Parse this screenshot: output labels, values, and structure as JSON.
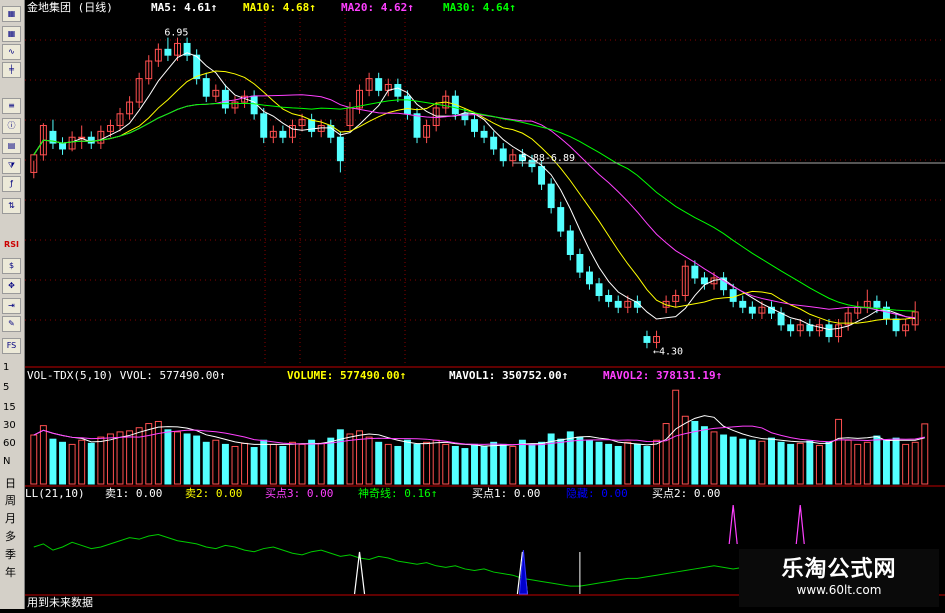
{
  "toolbar": {
    "icons": [
      "grid-icon",
      "grid-icon",
      "line-chart-icon",
      "candlestick-icon",
      "financial-icon",
      "stock-info-icon",
      "calendar-icon",
      "filter-icon",
      "formula-icon",
      "compare-icon",
      "rsi-icon",
      "dollar-icon",
      "move-icon",
      "export-icon",
      "draw-icon",
      "fullscreen-icon"
    ],
    "rsi_label": "RSI",
    "fs_label": "FS",
    "numbers": [
      "1",
      "5",
      "15",
      "30",
      "60",
      "N"
    ],
    "periods": [
      "日",
      "周",
      "月",
      "多",
      "季",
      "年"
    ]
  },
  "price_header": {
    "title": "金地集团 (日线)",
    "ma5": "MA5: 4.61↑",
    "ma10": "MA10: 4.68↑",
    "ma20": "MA20: 4.62↑",
    "ma30": "MA30: 4.64↑"
  },
  "vol_header": {
    "vvol": "VOL-TDX(5,10) VVOL: 577490.00↑",
    "volume": "VOLUME: 577490.00↑",
    "mavol1": "MAVOL1: 350752.00↑",
    "mavol2": "MAVOL2: 378131.19↑"
  },
  "ind_header": {
    "name": "LL(21,10)",
    "sell1": "卖1: 0.00",
    "sell2": "卖2: 0.00",
    "buy3": "买点3: 0.00",
    "magic": "神奇线: 0.16↑",
    "buy1": "买点1: 0.00",
    "hidden": "隐藏: 0.00",
    "buy2": "买点2: 0.00"
  },
  "footer_text": "用到未来数据",
  "watermark": {
    "title": "乐淘公式网",
    "url": "www.60lt.com"
  },
  "colors": {
    "up": "#ff5050",
    "down": "#54ffff",
    "ma5": "#ffffff",
    "ma10": "#ffff00",
    "ma20": "#ff40ff",
    "ma30": "#00ff00",
    "grid": "#8b0000"
  },
  "chart_data": [
    {
      "type": "candlestick",
      "title": "金地集团 (日线)",
      "annotations": [
        {
          "text": "6.95",
          "value": 6.95
        },
        {
          "text": "5.88-6.89",
          "value": 5.88
        },
        {
          "text": "4.30",
          "value": 4.3
        }
      ],
      "ylim": [
        4.2,
        7.1
      ],
      "candles": [
        [
          5.8,
          5.95,
          5.9,
          5.75
        ],
        [
          5.95,
          6.2,
          6.22,
          5.9
        ],
        [
          6.15,
          6.05,
          6.25,
          6.0
        ],
        [
          6.05,
          6.0,
          6.1,
          5.95
        ],
        [
          6.0,
          6.1,
          6.15,
          5.98
        ],
        [
          6.1,
          6.1,
          6.2,
          6.0
        ],
        [
          6.1,
          6.05,
          6.15,
          6.0
        ],
        [
          6.05,
          6.15,
          6.2,
          6.0
        ],
        [
          6.15,
          6.2,
          6.25,
          6.1
        ],
        [
          6.2,
          6.3,
          6.35,
          6.15
        ],
        [
          6.3,
          6.4,
          6.45,
          6.25
        ],
        [
          6.4,
          6.6,
          6.65,
          6.35
        ],
        [
          6.6,
          6.75,
          6.8,
          6.55
        ],
        [
          6.75,
          6.85,
          6.9,
          6.7
        ],
        [
          6.85,
          6.8,
          6.95,
          6.75
        ],
        [
          6.8,
          6.9,
          6.95,
          6.75
        ],
        [
          6.9,
          6.8,
          6.95,
          6.75
        ],
        [
          6.8,
          6.6,
          6.85,
          6.55
        ],
        [
          6.6,
          6.45,
          6.65,
          6.4
        ],
        [
          6.45,
          6.5,
          6.55,
          6.4
        ],
        [
          6.5,
          6.35,
          6.55,
          6.3
        ],
        [
          6.35,
          6.4,
          6.45,
          6.3
        ],
        [
          6.4,
          6.45,
          6.5,
          6.35
        ],
        [
          6.45,
          6.3,
          6.5,
          6.25
        ],
        [
          6.3,
          6.1,
          6.35,
          6.05
        ],
        [
          6.1,
          6.15,
          6.2,
          6.05
        ],
        [
          6.15,
          6.1,
          6.2,
          6.05
        ],
        [
          6.1,
          6.2,
          6.25,
          6.05
        ],
        [
          6.2,
          6.25,
          6.3,
          6.15
        ],
        [
          6.25,
          6.15,
          6.3,
          6.1
        ],
        [
          6.15,
          6.2,
          6.25,
          6.1
        ],
        [
          6.2,
          6.1,
          6.25,
          6.05
        ],
        [
          6.1,
          5.9,
          6.15,
          5.8
        ],
        [
          6.2,
          6.35,
          6.4,
          6.15
        ],
        [
          6.35,
          6.5,
          6.55,
          6.3
        ],
        [
          6.5,
          6.6,
          6.65,
          6.45
        ],
        [
          6.6,
          6.5,
          6.65,
          6.45
        ],
        [
          6.5,
          6.55,
          6.6,
          6.45
        ],
        [
          6.55,
          6.45,
          6.6,
          6.4
        ],
        [
          6.45,
          6.3,
          6.5,
          6.25
        ],
        [
          6.3,
          6.1,
          6.35,
          6.05
        ],
        [
          6.1,
          6.2,
          6.25,
          6.05
        ],
        [
          6.2,
          6.35,
          6.4,
          6.15
        ],
        [
          6.35,
          6.45,
          6.5,
          6.3
        ],
        [
          6.45,
          6.3,
          6.5,
          6.25
        ],
        [
          6.3,
          6.25,
          6.35,
          6.2
        ],
        [
          6.25,
          6.15,
          6.3,
          6.1
        ],
        [
          6.15,
          6.1,
          6.2,
          6.05
        ],
        [
          6.1,
          6.0,
          6.15,
          5.95
        ],
        [
          6.0,
          5.9,
          6.05,
          5.85
        ],
        [
          5.9,
          5.95,
          6.0,
          5.85
        ],
        [
          5.95,
          5.9,
          6.0,
          5.85
        ],
        [
          5.9,
          5.85,
          5.95,
          5.8
        ],
        [
          5.85,
          5.7,
          5.9,
          5.65
        ],
        [
          5.7,
          5.5,
          5.75,
          5.45
        ],
        [
          5.5,
          5.3,
          5.55,
          5.25
        ],
        [
          5.3,
          5.1,
          5.35,
          5.05
        ],
        [
          5.1,
          4.95,
          5.15,
          4.9
        ],
        [
          4.95,
          4.85,
          5.0,
          4.8
        ],
        [
          4.85,
          4.75,
          4.9,
          4.7
        ],
        [
          4.75,
          4.7,
          4.8,
          4.65
        ],
        [
          4.7,
          4.65,
          4.75,
          4.6
        ],
        [
          4.65,
          4.7,
          4.75,
          4.6
        ],
        [
          4.7,
          4.65,
          4.75,
          4.6
        ],
        [
          4.4,
          4.35,
          4.45,
          4.3
        ],
        [
          4.35,
          4.4,
          4.45,
          4.3
        ],
        [
          4.65,
          4.7,
          4.75,
          4.6
        ],
        [
          4.7,
          4.75,
          4.8,
          4.65
        ],
        [
          4.75,
          5.0,
          5.05,
          4.7
        ],
        [
          5.0,
          4.9,
          5.05,
          4.85
        ],
        [
          4.9,
          4.85,
          4.95,
          4.8
        ],
        [
          4.85,
          4.9,
          4.95,
          4.8
        ],
        [
          4.9,
          4.8,
          4.95,
          4.75
        ],
        [
          4.8,
          4.7,
          4.85,
          4.65
        ],
        [
          4.7,
          4.65,
          4.75,
          4.6
        ],
        [
          4.65,
          4.6,
          4.7,
          4.55
        ],
        [
          4.6,
          4.65,
          4.7,
          4.55
        ],
        [
          4.65,
          4.6,
          4.7,
          4.55
        ],
        [
          4.6,
          4.5,
          4.65,
          4.45
        ],
        [
          4.5,
          4.45,
          4.55,
          4.4
        ],
        [
          4.45,
          4.5,
          4.55,
          4.4
        ],
        [
          4.5,
          4.45,
          4.55,
          4.4
        ],
        [
          4.45,
          4.5,
          4.55,
          4.4
        ],
        [
          4.5,
          4.4,
          4.55,
          4.35
        ],
        [
          4.4,
          4.5,
          4.55,
          4.35
        ],
        [
          4.5,
          4.6,
          4.65,
          4.45
        ],
        [
          4.6,
          4.65,
          4.7,
          4.55
        ],
        [
          4.65,
          4.7,
          4.8,
          4.6
        ],
        [
          4.7,
          4.65,
          4.75,
          4.6
        ],
        [
          4.65,
          4.55,
          4.7,
          4.5
        ],
        [
          4.55,
          4.45,
          4.6,
          4.4
        ],
        [
          4.45,
          4.5,
          4.55,
          4.4
        ],
        [
          4.5,
          4.61,
          4.7,
          4.45
        ]
      ],
      "series": [
        {
          "name": "MA5",
          "color": "#ffffff"
        },
        {
          "name": "MA10",
          "color": "#ffff00"
        },
        {
          "name": "MA20",
          "color": "#ff40ff"
        },
        {
          "name": "MA30",
          "color": "#00ff00"
        }
      ]
    },
    {
      "type": "bar",
      "title": "VOL-TDX(5,10)",
      "values": [
        470,
        560,
        430,
        400,
        380,
        420,
        390,
        450,
        480,
        500,
        510,
        540,
        580,
        600,
        520,
        500,
        480,
        460,
        400,
        420,
        380,
        360,
        390,
        350,
        420,
        380,
        360,
        400,
        380,
        420,
        390,
        440,
        520,
        480,
        510,
        450,
        400,
        380,
        360,
        420,
        380,
        400,
        420,
        380,
        360,
        340,
        380,
        360,
        400,
        380,
        360,
        420,
        380,
        400,
        480,
        430,
        500,
        450,
        420,
        400,
        380,
        360,
        400,
        380,
        360,
        420,
        580,
        900,
        650,
        600,
        550,
        500,
        470,
        450,
        430,
        420,
        410,
        440,
        400,
        380,
        390,
        410,
        370,
        400,
        620,
        420,
        380,
        400,
        460,
        420,
        440,
        380,
        400,
        577
      ],
      "ylim": [
        0,
        950
      ],
      "series": [
        {
          "name": "MAVOL1",
          "color": "#ffffff"
        },
        {
          "name": "MAVOL2",
          "color": "#ff40ff"
        }
      ]
    },
    {
      "type": "line",
      "title": "LL(21,10)",
      "series": [
        {
          "name": "神奇线",
          "color": "#00cc00",
          "values": [
            0.3,
            0.32,
            0.28,
            0.3,
            0.33,
            0.31,
            0.29,
            0.3,
            0.32,
            0.34,
            0.36,
            0.35,
            0.37,
            0.38,
            0.36,
            0.34,
            0.33,
            0.32,
            0.3,
            0.29,
            0.31,
            0.3,
            0.28,
            0.27,
            0.29,
            0.3,
            0.28,
            0.26,
            0.25,
            0.27,
            0.28,
            0.26,
            0.24,
            0.25,
            0.23,
            0.22,
            0.24,
            0.23,
            0.21,
            0.2,
            0.19,
            0.2,
            0.18,
            0.17,
            0.18,
            0.16,
            0.15,
            0.16,
            0.14,
            0.13,
            0.12,
            0.1,
            0.09,
            0.08,
            0.07,
            0.06,
            0.05,
            0.05,
            0.06,
            0.07,
            0.08,
            0.09,
            0.1,
            0.1,
            0.11,
            0.12,
            0.13,
            0.14,
            0.15,
            0.16,
            0.17,
            0.18,
            0.17,
            0.16,
            0.17,
            0.18,
            0.19,
            0.18,
            0.17,
            0.18,
            0.19,
            0.2,
            0.19,
            0.18,
            0.17,
            0.16,
            0.15,
            0.16,
            0.17,
            0.16,
            0.15,
            0.16,
            0.17,
            0.16
          ]
        }
      ],
      "buy_spikes": [
        34,
        51
      ],
      "sell_spikes": [
        73,
        80
      ],
      "ylim": [
        0,
        0.6
      ]
    }
  ]
}
